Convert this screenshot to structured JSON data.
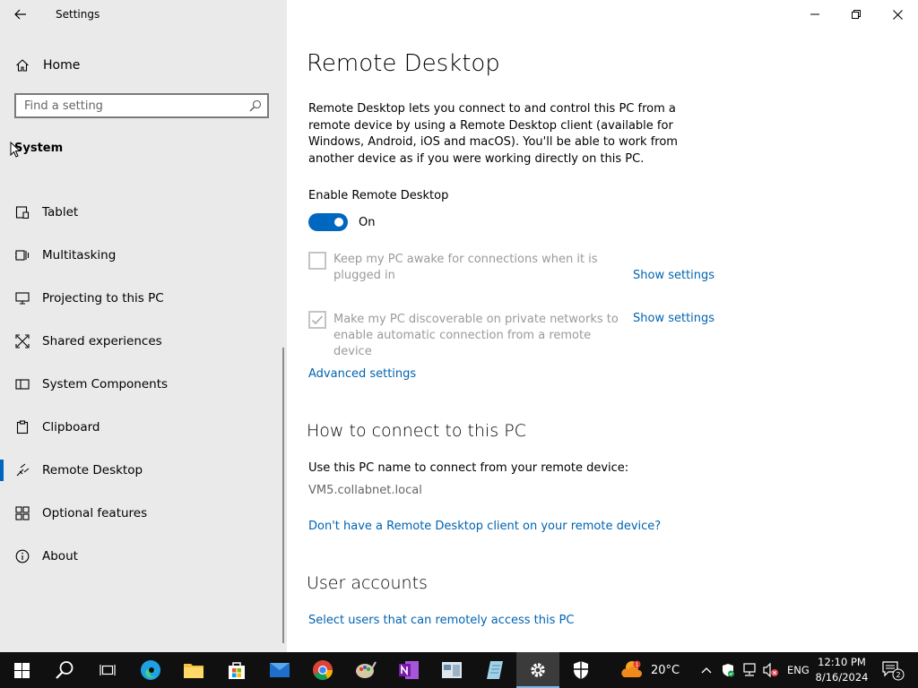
{
  "window": {
    "title": "Settings"
  },
  "sidebar": {
    "home_label": "Home",
    "search_placeholder": "Find a setting",
    "section_title": "System",
    "items": [
      {
        "label": "Tablet",
        "icon": "tablet-icon"
      },
      {
        "label": "Multitasking",
        "icon": "multitasking-icon"
      },
      {
        "label": "Projecting to this PC",
        "icon": "projecting-icon"
      },
      {
        "label": "Shared experiences",
        "icon": "shared-experiences-icon"
      },
      {
        "label": "System Components",
        "icon": "system-components-icon"
      },
      {
        "label": "Clipboard",
        "icon": "clipboard-icon"
      },
      {
        "label": "Remote Desktop",
        "icon": "remote-desktop-icon",
        "selected": true
      },
      {
        "label": "Optional features",
        "icon": "optional-features-icon"
      },
      {
        "label": "About",
        "icon": "info-icon"
      }
    ]
  },
  "main": {
    "title": "Remote Desktop",
    "description": "Remote Desktop lets you connect to and control this PC from a remote device by using a Remote Desktop client (available for Windows, Android, iOS and macOS). You'll be able to work from another device as if you were working directly on this PC.",
    "enable_label": "Enable Remote Desktop",
    "toggle_state": "On",
    "toggle_on": true,
    "options": [
      {
        "label": "Keep my PC awake for connections when it is plugged in",
        "checked": false,
        "link": "Show settings"
      },
      {
        "label": "Make my PC discoverable on private networks to enable automatic connection from a remote device",
        "checked": true,
        "link": "Show settings"
      }
    ],
    "advanced_link": "Advanced settings",
    "how_to_title": "How to connect to this PC",
    "how_to_text": "Use this PC name to connect from your remote device:",
    "pc_name": "VM5.collabnet.local",
    "client_link": "Don't have a Remote Desktop client on your remote device?",
    "user_accounts_title": "User accounts",
    "users_link": "Select users that can remotely access this PC"
  },
  "taskbar": {
    "apps": [
      "start-icon",
      "search-icon",
      "task-view-icon",
      "edge-icon",
      "file-explorer-icon",
      "store-icon",
      "mail-icon",
      "chrome-icon",
      "paint-icon",
      "onenote-icon",
      "remote-app-icon",
      "notepad-icon",
      "settings-icon",
      "security-icon"
    ],
    "weather_badge": "1",
    "temperature": "20°C",
    "language": "ENG",
    "time": "12:10 PM",
    "date": "8/16/2024",
    "notification_count": "2"
  },
  "colors": {
    "accent": "#0067c0",
    "link": "#0063b1",
    "sidebar_bg": "#eaeaea",
    "taskbar_bg": "#101010"
  }
}
